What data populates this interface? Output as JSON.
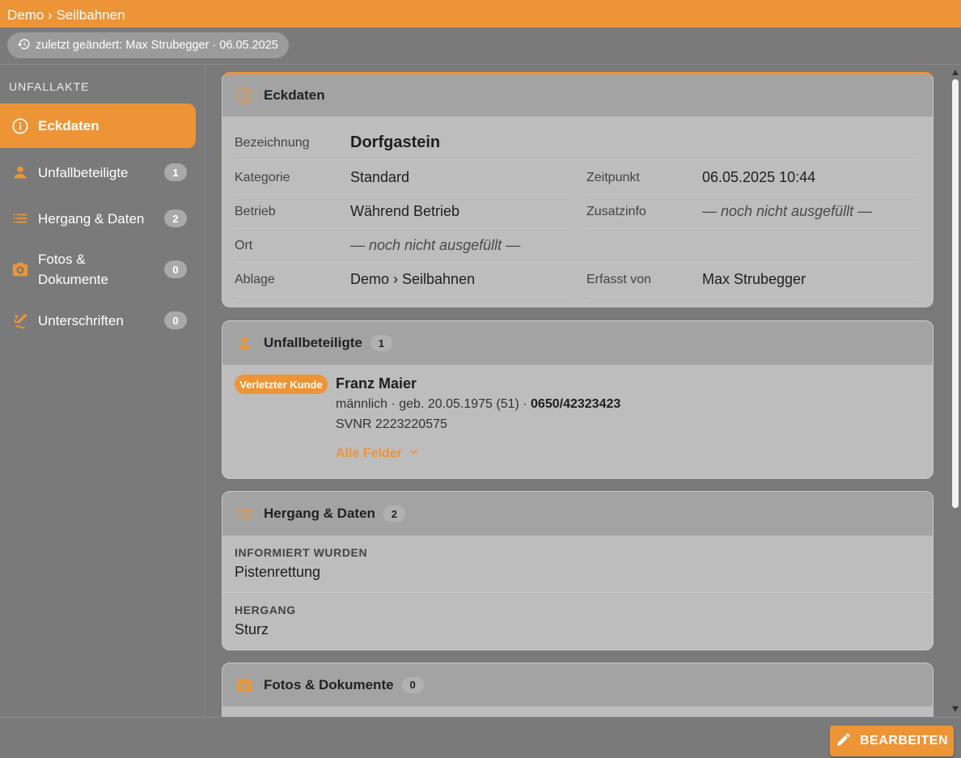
{
  "header": {
    "breadcrumb": "Demo › Seilbahnen"
  },
  "meta": {
    "last_changed": "zuletzt geändert: Max Strubegger · 06.05.2025"
  },
  "sidebar": {
    "heading": "UNFALLAKTE",
    "items": [
      {
        "label": "Eckdaten",
        "icon": "info-icon",
        "count": ""
      },
      {
        "label": "Unfallbeteiligte",
        "icon": "person-icon",
        "count": "1"
      },
      {
        "label": "Hergang & Daten",
        "icon": "list-icon",
        "count": "2"
      },
      {
        "label_line1": "Fotos &",
        "label_line2": "Dokumente",
        "icon": "camera-icon",
        "count": "0"
      },
      {
        "label": "Unterschriften",
        "icon": "signature-icon",
        "count": "0"
      }
    ]
  },
  "eckdaten": {
    "title": "Eckdaten",
    "bezeichnung_label": "Bezeichnung",
    "bezeichnung_value": "Dorfgastein",
    "kategorie_label": "Kategorie",
    "kategorie_value": "Standard",
    "zeitpunkt_label": "Zeitpunkt",
    "zeitpunkt_value": "06.05.2025 10:44",
    "betrieb_label": "Betrieb",
    "betrieb_value": "Während Betrieb",
    "zusatzinfo_label": "Zusatzinfo",
    "zusatzinfo_value": "— noch nicht ausgefüllt —",
    "ort_label": "Ort",
    "ort_value": "— noch nicht ausgefüllt —",
    "ablage_label": "Ablage",
    "ablage_value": "Demo › Seilbahnen",
    "erfasst_label": "Erfasst von",
    "erfasst_value": "Max Strubegger"
  },
  "beteiligte": {
    "title": "Unfallbeteiligte",
    "count": "1",
    "person": {
      "role": "Verletzter Kunde",
      "name": "Franz Maier",
      "details": "männlich · geb. 20.05.1975 (51) · ",
      "phone": "0650/42323423",
      "svnr": "SVNR 2223220575",
      "more_label": "Alle Felder"
    }
  },
  "hergang": {
    "title": "Hergang & Daten",
    "count": "2",
    "informiert_label": "INFORMIERT WURDEN",
    "informiert_value": "Pistenrettung",
    "hergang_label": "HERGANG",
    "hergang_value": "Sturz"
  },
  "fotos": {
    "title": "Fotos & Dokumente",
    "count": "0"
  },
  "footer": {
    "edit_label": "BEARBEITEN"
  },
  "colors": {
    "accent": "#ed9437",
    "background": "#7a7a7a",
    "card": "#bdbdbd",
    "card_header": "#a3a3a3"
  }
}
